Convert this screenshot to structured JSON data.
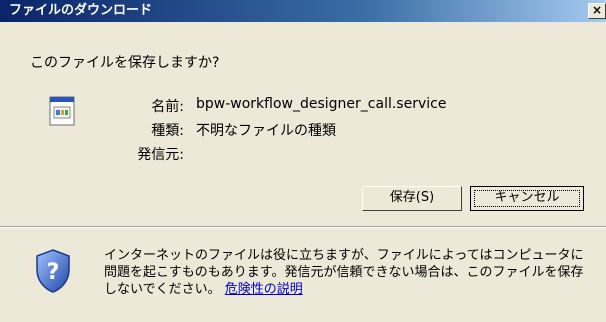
{
  "window": {
    "title": "ファイルのダウンロード",
    "close_label": "×"
  },
  "prompt": {
    "question": "このファイルを保存しますか?"
  },
  "file_info": {
    "name_label": "名前:",
    "name_value": "bpw-workflow_designer_call.service",
    "type_label": "種類:",
    "type_value": "不明なファイルの種類",
    "from_label": "発信元:",
    "from_value": ""
  },
  "buttons": {
    "save_label": "保存(S)",
    "cancel_label": "キャンセル"
  },
  "warning": {
    "text": "インターネットのファイルは役に立ちますが、ファイルによってはコンピュータに問題を起こすものもあります。発信元が信頼できない場合は、このファイルを保存しないでください。",
    "link_label": "危険性の説明"
  }
}
